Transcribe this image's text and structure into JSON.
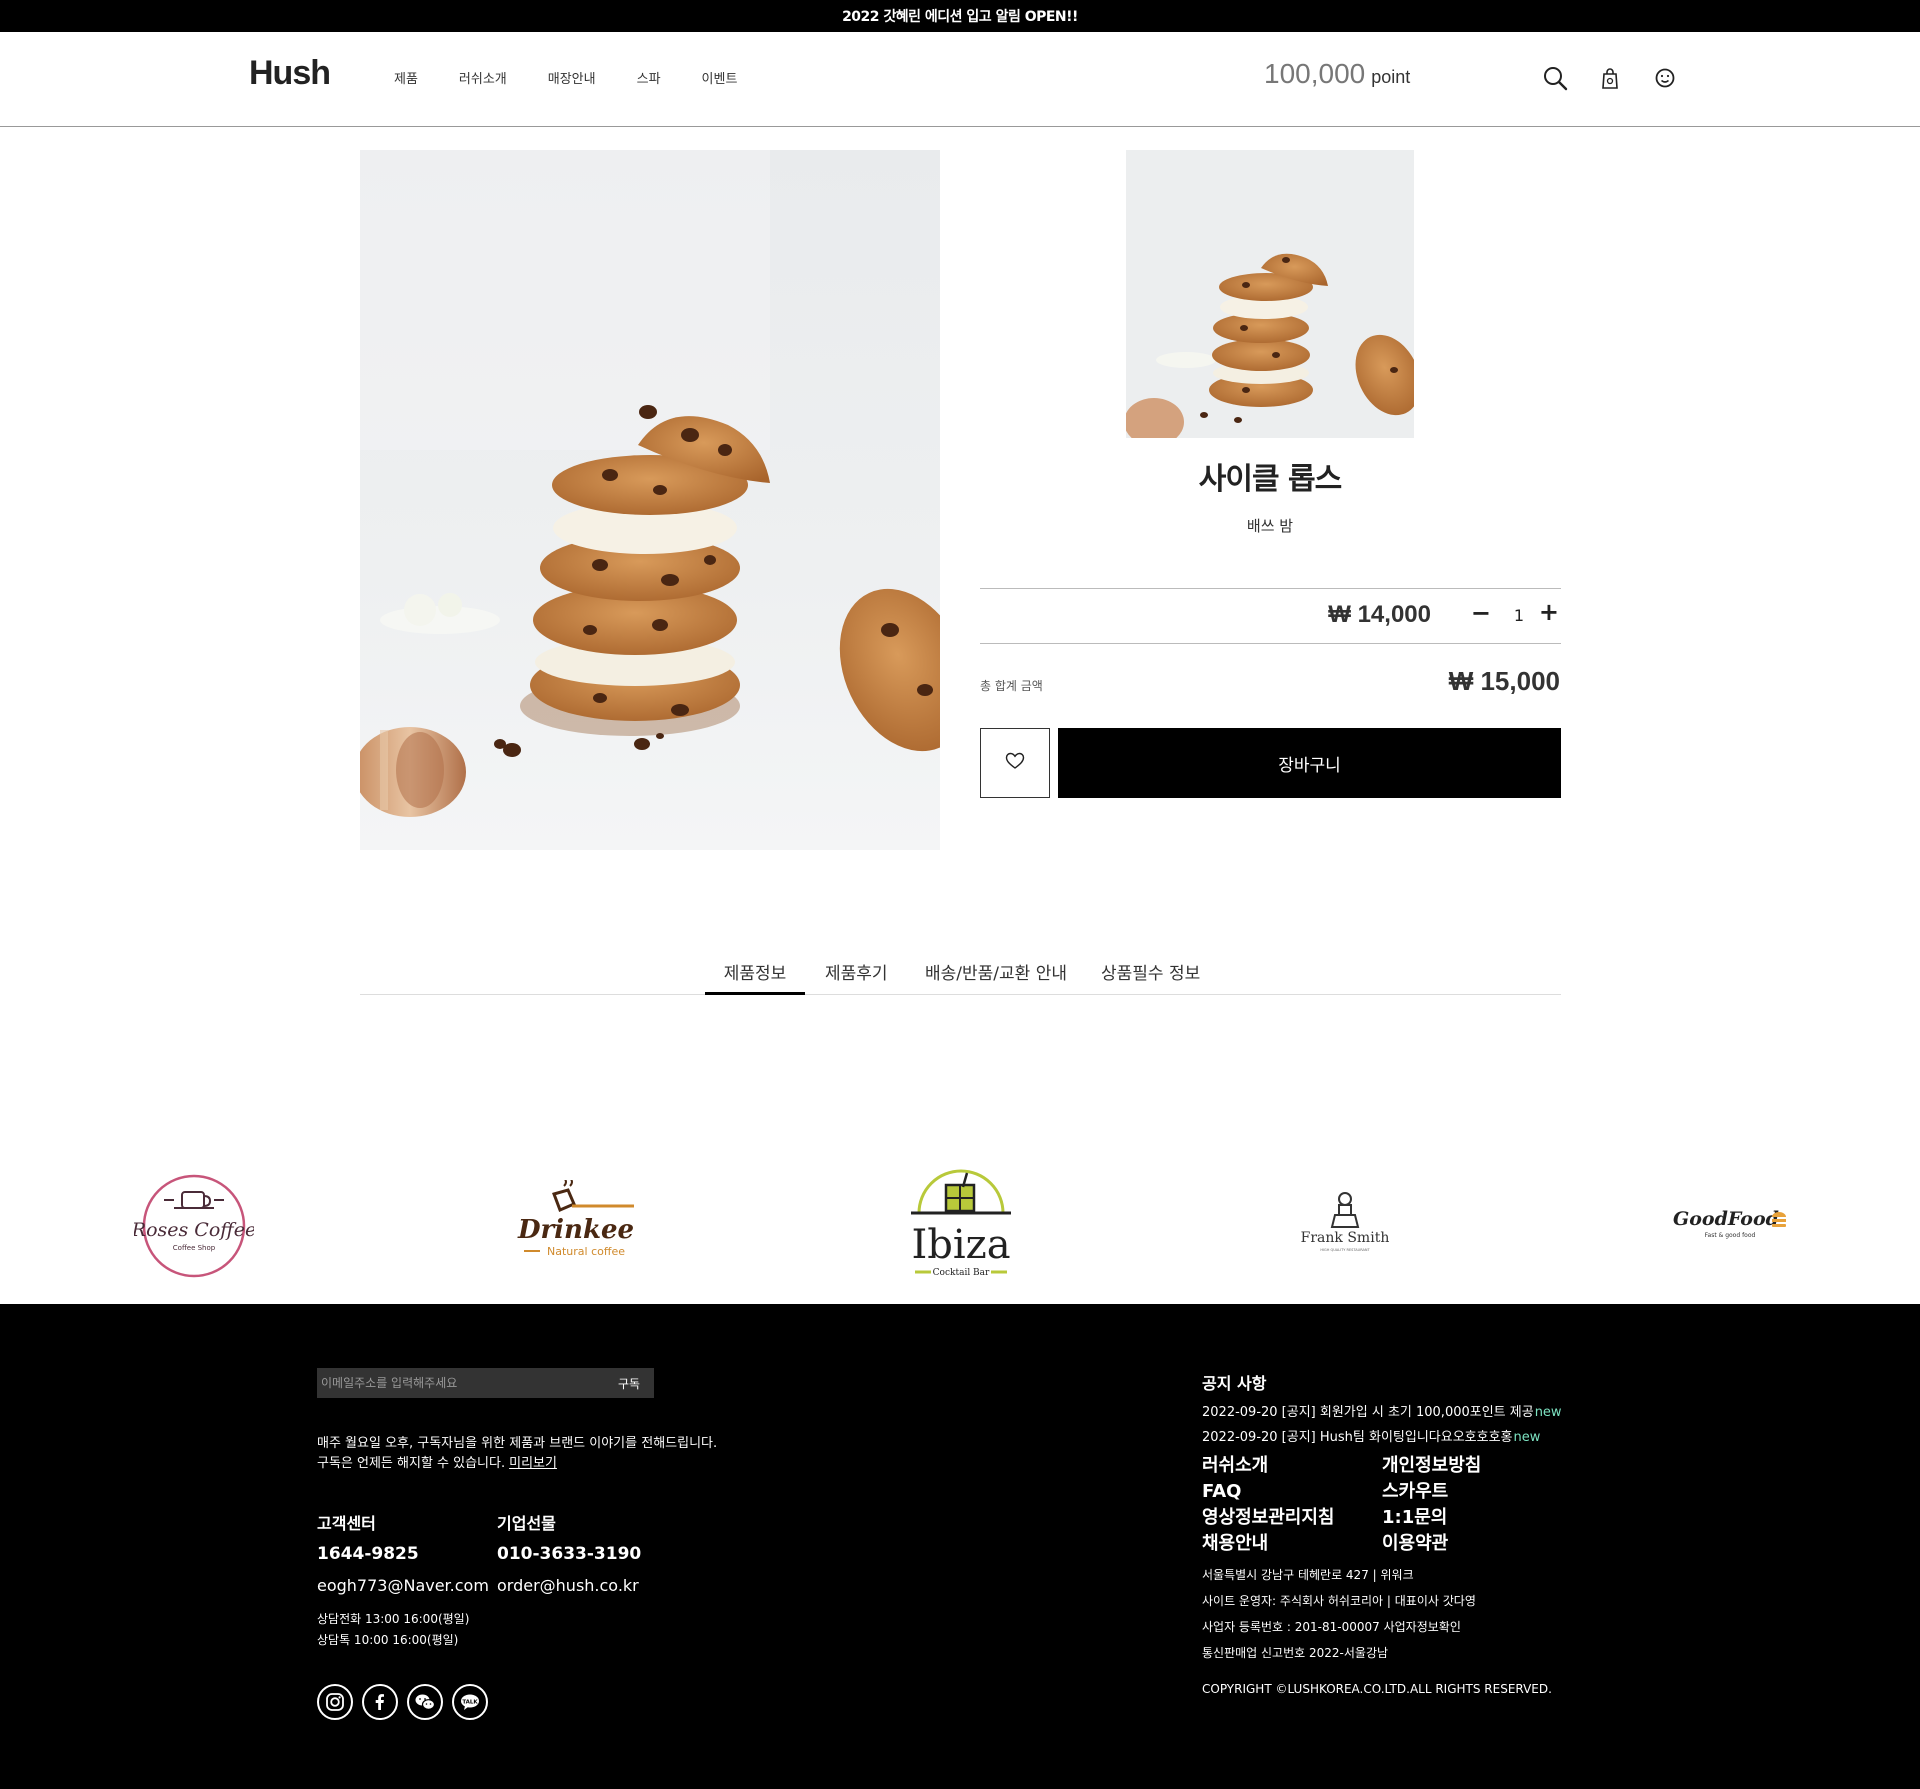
{
  "banner": {
    "text": "2022 갓혜린 에디션 입고 알림 OPEN!!"
  },
  "header": {
    "logo": "Hush",
    "nav": [
      "제품",
      "러쉬소개",
      "매장안내",
      "스파",
      "이벤트"
    ],
    "points_value": "100,000",
    "points_unit": "point",
    "icons": [
      "search-icon",
      "shopping-bag-icon",
      "smiley-icon"
    ]
  },
  "product": {
    "title": "사이클 롭스",
    "subtitle": "배쓰 밤",
    "price": "₩ 14,000",
    "quantity": "1",
    "qty_minus": "−",
    "qty_plus": "+",
    "total_label": "총 합계 금액",
    "total_value": "₩ 15,000",
    "cart_label": "장바구니"
  },
  "tabs": [
    {
      "label": "제품정보",
      "active": true
    },
    {
      "label": "제품후기",
      "active": false
    },
    {
      "label": "배송/반품/교환 안내",
      "active": false
    },
    {
      "label": "상품필수 정보",
      "active": false
    }
  ],
  "brands": {
    "roses": {
      "name": "Roses Coffee",
      "sub": "Coffee Shop"
    },
    "drinkee": {
      "name": "Drinkee",
      "sub": "Natural coffee"
    },
    "ibiza": {
      "name": "Ibiza",
      "sub": "Cocktail Bar"
    },
    "frank": {
      "name": "Frank Smith",
      "sub": "HIGH QUALITY RESTAURANT"
    },
    "goodfood": {
      "name": "GoodFood",
      "sub": "Fast & good food"
    }
  },
  "footer": {
    "subscribe_placeholder": "이메일주소를 입력해주세요",
    "subscribe_button": "구독",
    "news_line1": "매주 월요일 오후, 구독자님을 위한 제품과 브랜드 이야기를 전해드립니다.",
    "news_line2": "구독은 언제든 해지할 수 있습니다.",
    "more_link": "미리보기",
    "cs": {
      "title": "고객센터",
      "phone": "1644-9825",
      "email": "eogh773@Naver.com",
      "hours1": "상담전화 13:00 16:00(평일)",
      "hours2": "상담톡 10:00 16:00(평일)"
    },
    "corp": {
      "title": "기업선물",
      "phone": "010-3633-3190",
      "email": "order@hush.co.kr"
    },
    "socials": [
      "instagram-icon",
      "facebook-icon",
      "wechat-icon",
      "kakaotalk-icon"
    ],
    "notice_title": "공지 사항",
    "notices": [
      {
        "text": "2022-09-20 [공지] 회원가입 시 초기 100,000포인트 제공",
        "badge": "new"
      },
      {
        "text": "2022-09-20 [공지] Hush팀 화이팅입니다요오호호호홍",
        "badge": "new"
      }
    ],
    "links": [
      "러쉬소개",
      "개인정보방침",
      "FAQ",
      "스카우트",
      "영상정보관리지침",
      "1:1문의",
      "채용안내",
      "이용약관"
    ],
    "address": "서울특별시 강남구 테헤란로 427 | 위워크",
    "operator": "사이트 운영자: 주식회사 허쉬코리아 | 대표이사 갓다영",
    "business": "사업자 등록번호 : 201-81-00007 사업자정보확인",
    "mailorder": "통신판매업 신고번호 2022-서울강남",
    "copyright": "COPYRIGHT ©LUSHKOREA.CO.LTD.ALL RIGHTS RESERVED."
  }
}
